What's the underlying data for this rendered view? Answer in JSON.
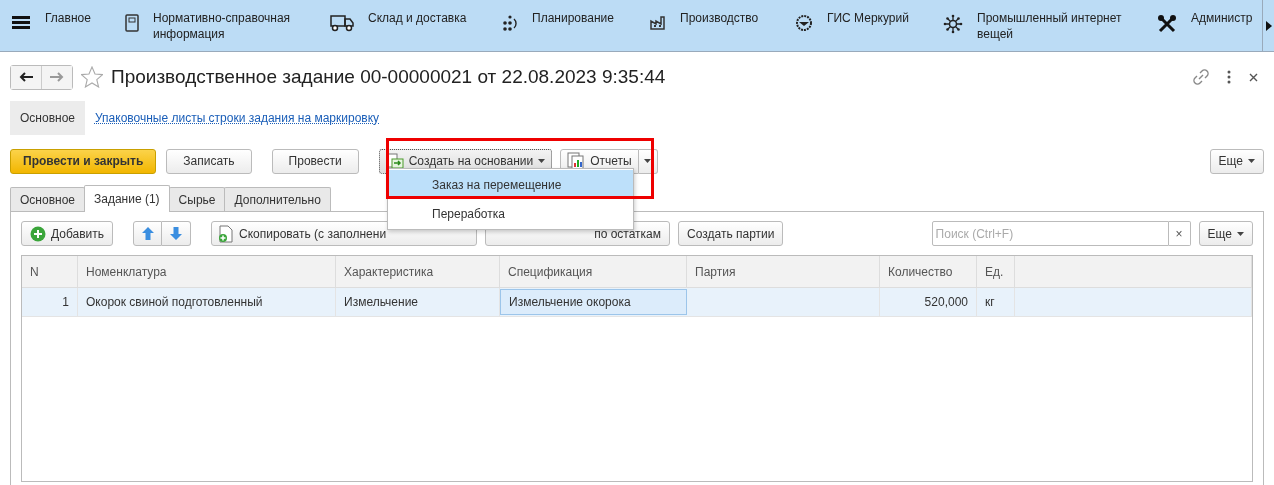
{
  "top_nav": {
    "items": [
      {
        "kind": "menu",
        "label": "Главное"
      },
      {
        "kind": "book",
        "label": "Нормативно-справочная информация"
      },
      {
        "kind": "truck",
        "label": "Склад и доставка"
      },
      {
        "kind": "dots",
        "label": "Планирование"
      },
      {
        "kind": "factory",
        "label": "Производство"
      },
      {
        "kind": "gis",
        "label": "ГИС Меркурий"
      },
      {
        "kind": "iot",
        "label": "Промышленный интернет вещей"
      },
      {
        "kind": "tools",
        "label": "Администр"
      }
    ]
  },
  "form": {
    "title": "Производственное задание 00-00000021 от 22.08.2023 9:35:44",
    "nav_links": [
      {
        "label": "Основное",
        "selected": true
      },
      {
        "label": "Упаковочные листы строки задания на маркировку",
        "selected": false
      }
    ],
    "command_bar": [
      {
        "kind": "primary",
        "label": "Провести и закрыть"
      },
      {
        "kind": "plain",
        "label": "Записать"
      },
      {
        "kind": "plain",
        "label": "Провести"
      },
      {
        "kind": "dropdown",
        "label": "Создать на основании",
        "pressed": true
      },
      {
        "kind": "split",
        "label": "Отчеты"
      }
    ],
    "more_label": "Еще",
    "create_menu": {
      "items": [
        {
          "label": "Заказ на перемещение",
          "selected": true
        },
        {
          "label": "Переработка",
          "selected": false
        }
      ]
    },
    "tabs": [
      {
        "label": "Основное",
        "selected": false
      },
      {
        "label": "Задание (1)",
        "selected": true
      },
      {
        "label": "Сырье",
        "selected": false
      },
      {
        "label": "Дополнительно",
        "selected": false
      }
    ],
    "table_toolbar": [
      {
        "kind": "add",
        "label": "Добавить"
      },
      {
        "kind": "up"
      },
      {
        "kind": "down"
      },
      {
        "kind": "copy",
        "label": "Скопировать (с заполнени"
      },
      {
        "kind": "pick",
        "label": "по остаткам"
      },
      {
        "kind": "plain",
        "label": "Создать партии"
      }
    ],
    "search": {
      "placeholder": "Поиск (Ctrl+F)",
      "clear": "×"
    },
    "table_more_label": "Еще",
    "table": {
      "columns": [
        "N",
        "Номенклатура",
        "Характеристика",
        "Спецификация",
        "Партия",
        "Количество",
        "Ед."
      ],
      "rows": [
        {
          "selected": true,
          "cells": [
            {
              "text": "1",
              "focused": false
            },
            {
              "text": "Окорок свиной подготовленный",
              "focused": false
            },
            {
              "text": "Измельчение",
              "focused": false
            },
            {
              "text": "Измельчение окорока",
              "focused": true
            },
            {
              "text": "",
              "focused": false
            },
            {
              "text": "520,000",
              "focused": false
            },
            {
              "text": "кг",
              "focused": false
            }
          ]
        }
      ]
    }
  }
}
